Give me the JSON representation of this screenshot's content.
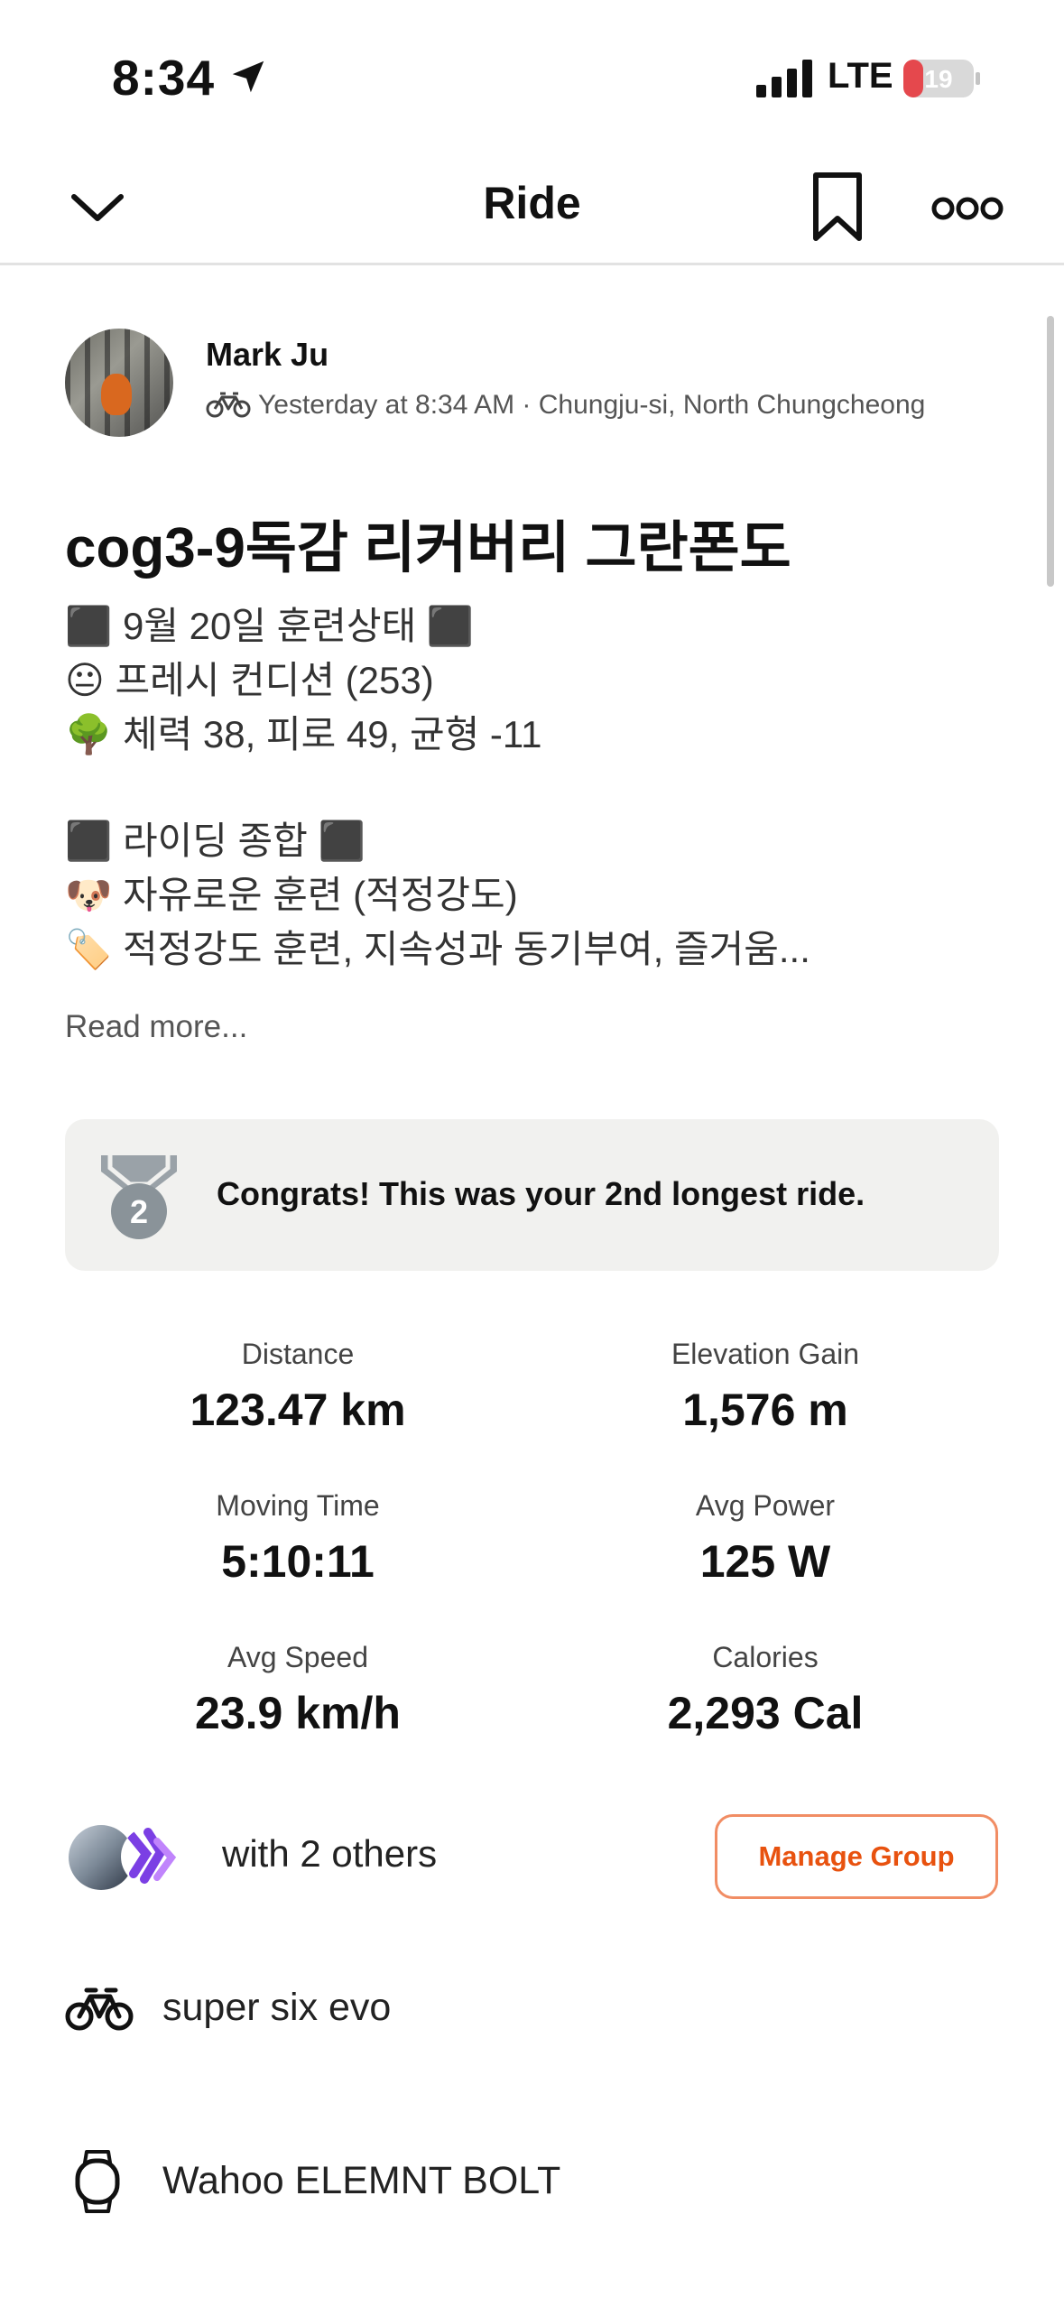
{
  "status_bar": {
    "time": "8:34",
    "network": "LTE",
    "battery_level": "19",
    "battery_color": "#e5484d"
  },
  "header": {
    "title": "Ride",
    "icons": [
      "chevron-down-icon",
      "bookmark-icon",
      "more-icon"
    ]
  },
  "author": {
    "name": "Mark Ju",
    "meta": "Yesterday at 8:34 AM · Chungju-si, North Chungcheong"
  },
  "activity": {
    "title": "cog3-9독감 리커버리 그란폰도",
    "description": [
      "⬛ 9월 20일 훈련상태 ⬛",
      "😐 프레시 컨디션 (253)",
      "🌳 체력 38, 피로 49, 균형 -11",
      "",
      "⬛ 라이딩 종합 ⬛",
      "🐶 자유로운 훈련 (적정강도)",
      "🏷️ 적정강도 훈련, 지속성과 동기부여, 즐거움..."
    ],
    "read_more": "Read more..."
  },
  "achievement": {
    "medal_number": "2",
    "text": "Congrats! This was your 2nd longest ride."
  },
  "stats": [
    {
      "label": "Distance",
      "value": "123.47 km"
    },
    {
      "label": "Elevation Gain",
      "value": "1,576 m"
    },
    {
      "label": "Moving Time",
      "value": "5:10:11"
    },
    {
      "label": "Avg Power",
      "value": "125 W"
    },
    {
      "label": "Avg Speed",
      "value": "23.9 km/h"
    },
    {
      "label": "Calories",
      "value": "2,293 Cal"
    }
  ],
  "group": {
    "text": "with 2 others",
    "button": "Manage Group",
    "accent_color": "#e8520f"
  },
  "gear": {
    "bike": "super six evo",
    "device": "Wahoo ELEMNT BOLT"
  }
}
